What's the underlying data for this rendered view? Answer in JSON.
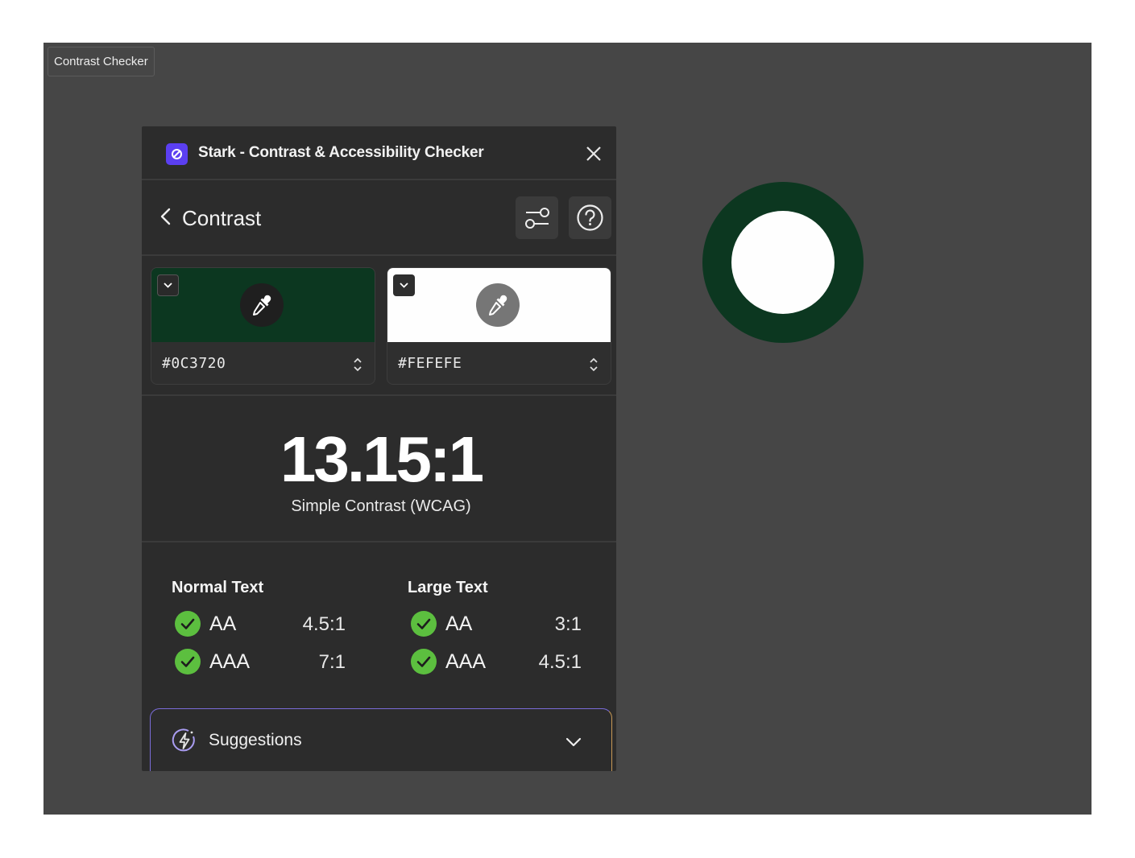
{
  "frame": {
    "label": "Contrast Checker"
  },
  "plugin": {
    "title": "Stark - Contrast & Accessibility Checker",
    "logo_icon": "stark-logo-icon",
    "close_icon": "close-icon"
  },
  "nav": {
    "title": "Contrast",
    "back_icon": "chevron-left-icon",
    "settings_icon": "sliders-icon",
    "help_icon": "help-circle-icon"
  },
  "foreground": {
    "hex": "#0C3720",
    "color": "#0c3720"
  },
  "background": {
    "hex": "#FEFEFE",
    "color": "#fefefe"
  },
  "result": {
    "ratio": "13.15:1",
    "label": "Simple Contrast (WCAG)"
  },
  "compliance": {
    "normal": {
      "title": "Normal Text",
      "rows": [
        {
          "level": "AA",
          "requirement": "4.5:1",
          "pass": true
        },
        {
          "level": "AAA",
          "requirement": "7:1",
          "pass": true
        }
      ]
    },
    "large": {
      "title": "Large Text",
      "rows": [
        {
          "level": "AA",
          "requirement": "3:1",
          "pass": true
        },
        {
          "level": "AAA",
          "requirement": "4.5:1",
          "pass": true
        }
      ]
    },
    "pass_color": "#5cbf3f"
  },
  "suggestions": {
    "label": "Suggestions",
    "icon": "lightning-circle-icon"
  },
  "preview": {
    "ring_color": "#0c3720",
    "center_color": "#fefefe"
  }
}
